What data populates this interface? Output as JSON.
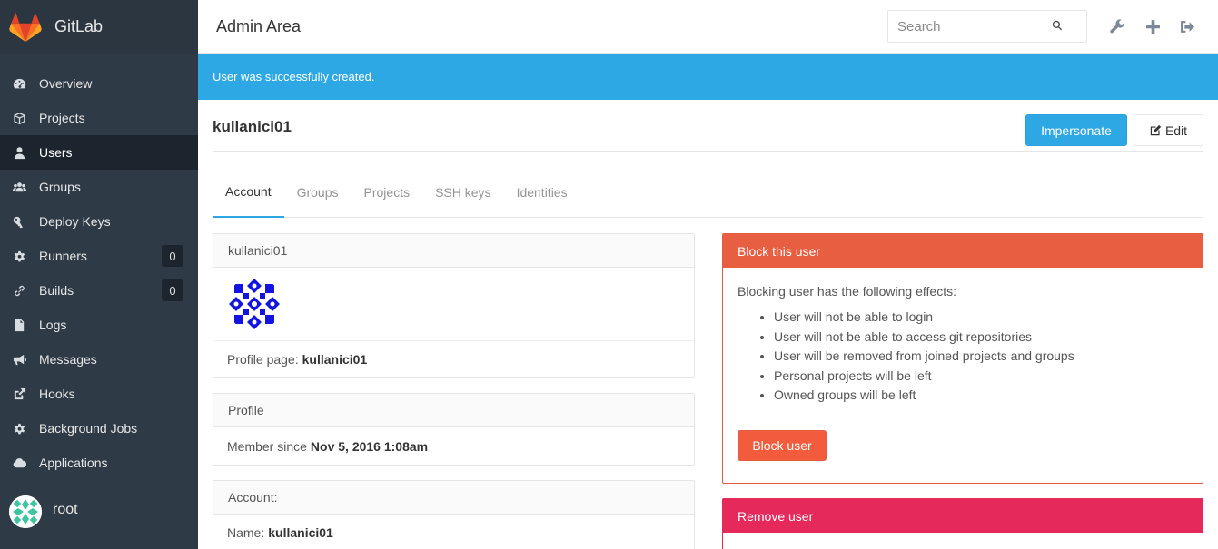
{
  "brand": {
    "name": "GitLab"
  },
  "sidebar": {
    "items": [
      {
        "label": "Overview",
        "icon": "dashboard-icon"
      },
      {
        "label": "Projects",
        "icon": "cube-icon"
      },
      {
        "label": "Users",
        "icon": "user-icon",
        "active": true
      },
      {
        "label": "Groups",
        "icon": "users-icon"
      },
      {
        "label": "Deploy Keys",
        "icon": "key-icon"
      },
      {
        "label": "Runners",
        "icon": "cog-icon",
        "badge": "0"
      },
      {
        "label": "Builds",
        "icon": "link-icon",
        "badge": "0"
      },
      {
        "label": "Logs",
        "icon": "file-text-icon"
      },
      {
        "label": "Messages",
        "icon": "bullhorn-icon"
      },
      {
        "label": "Hooks",
        "icon": "external-link-icon"
      },
      {
        "label": "Background Jobs",
        "icon": "cog-icon"
      },
      {
        "label": "Applications",
        "icon": "cloud-icon"
      }
    ],
    "user": {
      "name": "root"
    }
  },
  "header": {
    "title": "Admin Area",
    "search_placeholder": "Search"
  },
  "flash": {
    "message": "User was successfully created."
  },
  "user": {
    "title": "kullanici01",
    "impersonate_label": "Impersonate",
    "edit_label": "Edit"
  },
  "tabs": [
    "Account",
    "Groups",
    "Projects",
    "SSH keys",
    "Identities"
  ],
  "panels": {
    "user_heading": "kullanici01",
    "profile_page_label": "Profile page:",
    "profile_page_value": "kullanici01",
    "profile_heading": "Profile",
    "member_since_label": "Member since",
    "member_since_value": "Nov 5, 2016 1:08am",
    "account_heading": "Account:",
    "name_label": "Name:",
    "name_value": "kullanici01"
  },
  "block": {
    "heading": "Block this user",
    "intro": "Blocking user has the following effects:",
    "effects": [
      "User will not be able to login",
      "User will not be able to access git repositories",
      "User will be removed from joined projects and groups",
      "Personal projects will be left",
      "Owned groups will be left"
    ],
    "button": "Block user"
  },
  "remove": {
    "heading": "Remove user"
  },
  "colors": {
    "sidebar": "#2e3a46",
    "accent": "#2ea8e5",
    "danger": "#e75e40",
    "remove": "#e5295a"
  }
}
